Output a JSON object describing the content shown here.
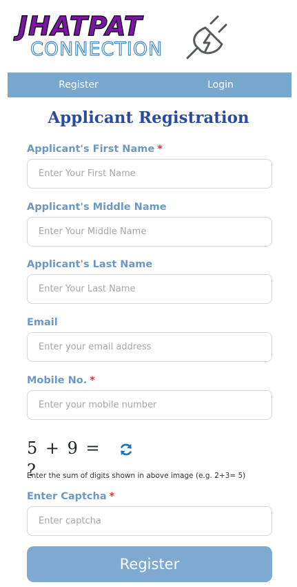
{
  "logo": {
    "line1": "JHATPAT",
    "line2": "CONNECTION",
    "icon": "plug-icon"
  },
  "nav": {
    "register_label": "Register",
    "login_label": "Login"
  },
  "form": {
    "title": "Applicant Registration",
    "required_marker": "*",
    "fields": {
      "first_name": {
        "label": "Applicant's First Name",
        "placeholder": "Enter Your First Name",
        "value": ""
      },
      "middle_name": {
        "label": "Applicant's Middle Name",
        "placeholder": "Enter Your Middle Name",
        "value": ""
      },
      "last_name": {
        "label": "Applicant's Last Name",
        "placeholder": "Enter Your Last Name",
        "value": ""
      },
      "email": {
        "label": "Email",
        "placeholder": "Enter your email address",
        "value": ""
      },
      "mobile": {
        "label": "Mobile No.",
        "placeholder": "Enter your mobile number",
        "value": ""
      },
      "captcha": {
        "label": "Enter Captcha",
        "placeholder": "Enter captcha",
        "value": ""
      }
    },
    "captcha_image_text": "5 + 9 = ?",
    "captcha_hint": "Enter the sum of digits shown in above image (e.g. 2+3= 5)",
    "refresh_icon": "refresh-icon",
    "submit_label": "Register"
  },
  "colors": {
    "nav_background": "#77a8ce",
    "title": "#2b4ba0",
    "label": "#6d98c4",
    "required": "#e02f3c",
    "submit_background": "#7eaad2",
    "logo_purple": "#7d16a8",
    "refresh_blue": "#1a73c7"
  }
}
